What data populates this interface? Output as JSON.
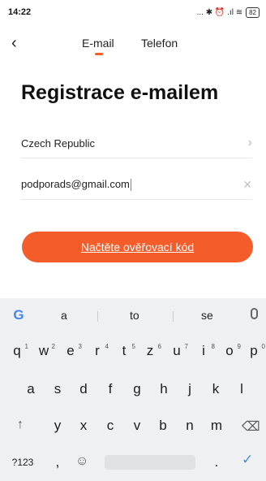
{
  "statusbar": {
    "time": "14:22",
    "icons": "... ✱ ⏰ .ıl ≋",
    "battery": "82"
  },
  "nav": {
    "back_icon": "‹",
    "tabs": [
      "E-mail",
      "Telefon"
    ],
    "active": 0
  },
  "title": "Registrace e-mailem",
  "country": {
    "value": "Czech Republic",
    "icon": "chevron-right-icon"
  },
  "email": {
    "value": "podporads@gmail.com",
    "icon": "clear-icon"
  },
  "cta": {
    "label": "Načtěte ověřovací kód",
    "color": "#f45d2a"
  },
  "keyboard": {
    "suggestions": [
      "a",
      "to",
      "se"
    ],
    "row1": [
      "q",
      "w",
      "e",
      "r",
      "t",
      "z",
      "u",
      "i",
      "o",
      "p"
    ],
    "row1_numbers": [
      "1",
      "2",
      "3",
      "4",
      "5",
      "6",
      "7",
      "8",
      "9",
      "0"
    ],
    "row2": [
      "a",
      "s",
      "d",
      "f",
      "g",
      "h",
      "j",
      "k",
      "l"
    ],
    "row3": [
      "y",
      "x",
      "c",
      "v",
      "b",
      "n",
      "m"
    ],
    "row4": {
      "symbols": "?123",
      "comma": ",",
      "period": "."
    }
  }
}
